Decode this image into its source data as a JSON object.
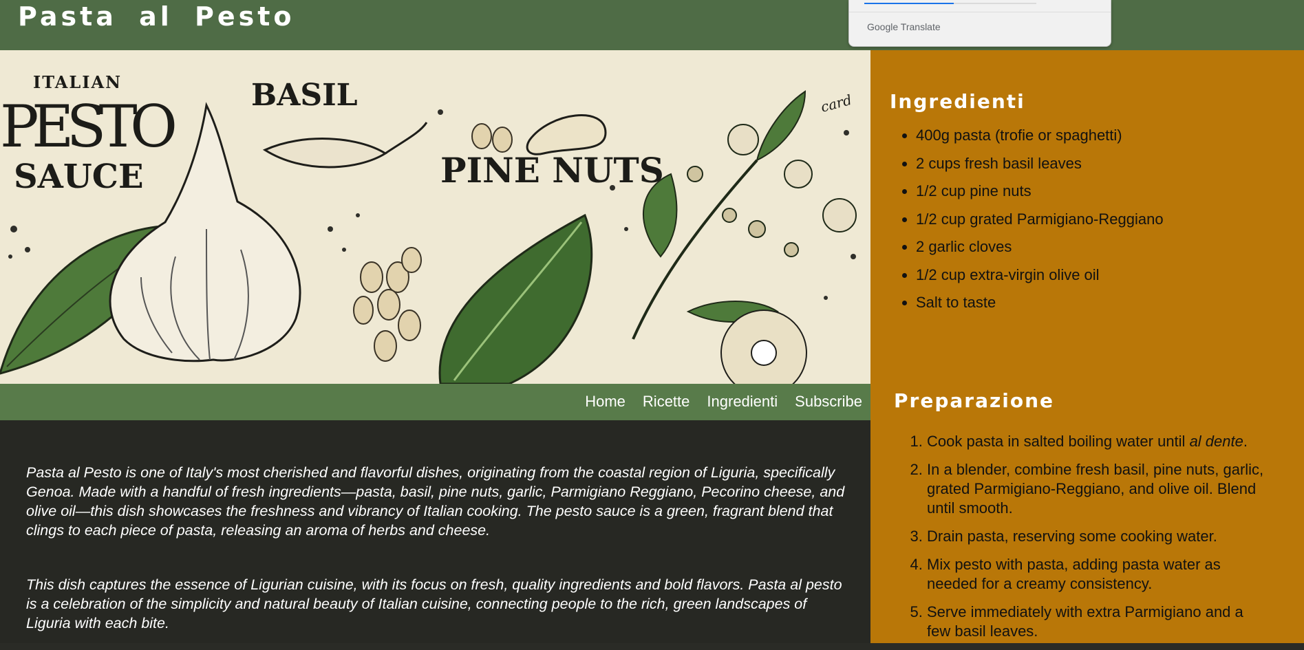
{
  "header": {
    "site_title": "Pasta al Pesto",
    "translate_powered_by": "Google",
    "translate_label": "Translate"
  },
  "hero": {
    "label_italian": "ITALIAN",
    "label_pesto": "PESTO",
    "label_sauce": "SAUCE",
    "label_basil": "BASIL",
    "label_pine_nuts": "PINE NUTS",
    "label_corner": "card"
  },
  "nav": {
    "items": [
      "Home",
      "Ricette",
      "Ingredienti",
      "Subscribe"
    ]
  },
  "main": {
    "paragraphs": [
      "Pasta al Pesto is one of Italy's most cherished and flavorful dishes, originating from the coastal region of Liguria, specifically Genoa. Made with a handful of fresh ingredients—pasta, basil, pine nuts, garlic, Parmigiano Reggiano, Pecorino cheese, and olive oil—this dish showcases the freshness and vibrancy of Italian cooking. The pesto sauce is a green, fragrant blend that clings to each piece of pasta, releasing an aroma of herbs and cheese.",
      "This dish captures the essence of Ligurian cuisine, with its focus on fresh, quality ingredients and bold flavors. Pasta al pesto is a celebration of the simplicity and natural beauty of Italian cuisine, connecting people to the rich, green landscapes of Liguria with each bite."
    ]
  },
  "sidebar": {
    "ingredients_title": "Ingredienti",
    "ingredients": [
      "400g pasta (trofie or spaghetti)",
      "2 cups fresh basil leaves",
      "1/2 cup pine nuts",
      "1/2 cup grated Parmigiano-Reggiano",
      "2 garlic cloves",
      "1/2 cup extra-virgin olive oil",
      "Salt to taste"
    ],
    "preparation_title": "Preparazione",
    "steps": [
      {
        "text": "Cook pasta in salted boiling water until ",
        "em": "al dente",
        "tail": "."
      },
      {
        "text": "In a blender, combine fresh basil, pine nuts, garlic, grated Parmigiano-Reggiano, and olive oil. Blend until smooth."
      },
      {
        "text": "Drain pasta, reserving some cooking water."
      },
      {
        "text": "Mix pesto with pasta, adding pasta water as needed for a creamy consistency."
      },
      {
        "text": "Serve immediately with extra Parmigiano and a few basil leaves."
      }
    ]
  },
  "colors": {
    "topbar": "#4f6c46",
    "nav": "#587b4a",
    "sidebar": "#b97708",
    "main_bg": "#272823",
    "hero_bg": "#efe9d4"
  }
}
